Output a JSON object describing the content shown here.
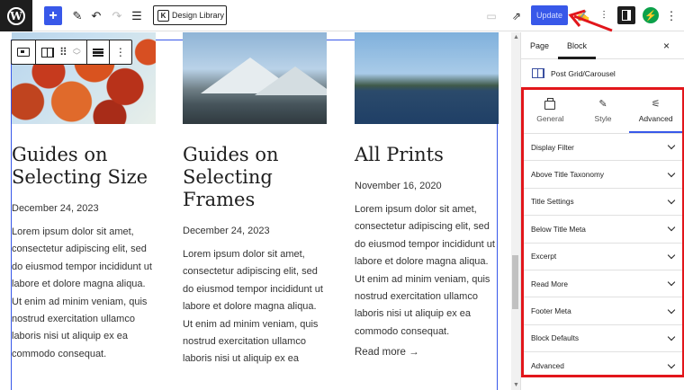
{
  "toolbar": {
    "wp_logo_letter": "W",
    "add_icon": "plus",
    "tools": [
      "pencil-icon",
      "undo-icon",
      "redo-icon",
      "list-view-icon"
    ],
    "design_library_label": "Design Library",
    "design_library_icon_letter": "K",
    "update_label": "Update"
  },
  "block_toolbar": {
    "icons": [
      "slider-icon",
      "grid-icon",
      "drag-icon",
      "move-up-down-icon",
      "align-icon",
      "more-options-icon"
    ]
  },
  "posts": [
    {
      "title": "Guides on Selecting Size",
      "date": "December 24, 2023",
      "excerpt": "Lorem ipsum dolor sit amet, consectetur adipiscing elit, sed do eiusmod tempor incididunt ut labore et dolore magna aliqua. Ut enim ad minim veniam, quis nostrud exercitation ullamco laboris nisi ut aliquip ex ea commodo consequat.",
      "image": "autumn-tree"
    },
    {
      "title": "Guides on Selecting Frames",
      "date": "December 24, 2023",
      "excerpt": "Lorem ipsum dolor sit amet, consectetur adipiscing elit, sed do eiusmod tempor incididunt ut labore et dolore magna aliqua. Ut enim ad minim veniam, quis nostrud exercitation ullamco laboris nisi ut aliquip ex ea",
      "image": "snowy-mountains"
    },
    {
      "title": "All Prints",
      "date": "November 16, 2020",
      "excerpt": "Lorem ipsum dolor sit amet, consectetur adipiscing elit, sed do eiusmod tempor incididunt ut labore et dolore magna aliqua. Ut enim ad minim veniam, quis nostrud exercitation ullamco laboris nisi ut aliquip ex ea commodo consequat.",
      "read_more": "Read more →",
      "image": "lake"
    }
  ],
  "sidebar": {
    "tabs": [
      {
        "label": "Page"
      },
      {
        "label": "Block",
        "active": true
      }
    ],
    "close_icon": "×",
    "block_name": "Post Grid/Carousel",
    "settings_tabs": [
      {
        "label": "General",
        "icon": "briefcase-icon"
      },
      {
        "label": "Style",
        "icon": "brush-icon"
      },
      {
        "label": "Advanced",
        "icon": "sliders-icon",
        "active": true
      }
    ],
    "panels": [
      {
        "label": "Display Filter"
      },
      {
        "label": "Above Title Taxonomy"
      },
      {
        "label": "Title Settings"
      },
      {
        "label": "Below Title Meta"
      },
      {
        "label": "Excerpt"
      },
      {
        "label": "Read More"
      },
      {
        "label": "Footer Meta"
      },
      {
        "label": "Block Defaults"
      },
      {
        "label": "Advanced"
      }
    ]
  },
  "colors": {
    "accent": "#3858e9",
    "highlight": "#e2161b",
    "dark": "#1e1e1e",
    "green": "#0ca14a"
  }
}
